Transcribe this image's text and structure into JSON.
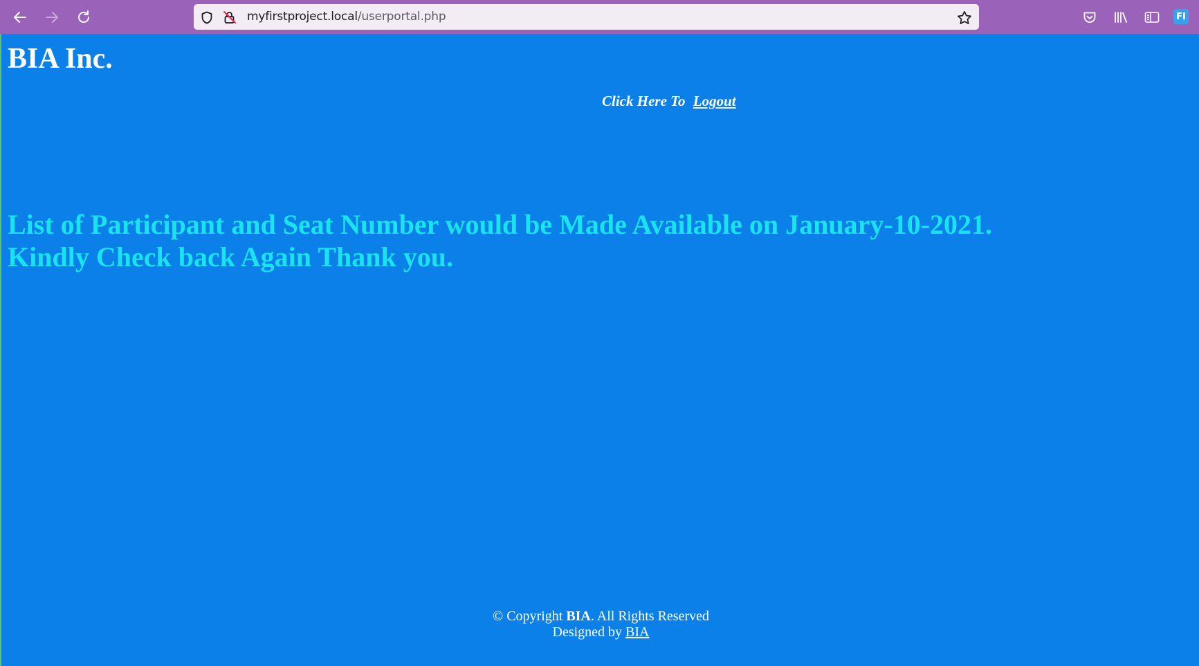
{
  "browser": {
    "url_host": "myfirstproject.local",
    "url_path": "/userportal.php",
    "toolbar_color": "#9a63b9",
    "icons": {
      "back": "back-arrow-icon",
      "forward": "forward-arrow-icon",
      "reload": "reload-icon",
      "shield": "tracking-protection-shield-icon",
      "lock": "insecure-lock-icon",
      "bookmark": "bookmark-star-icon",
      "pocket": "pocket-icon",
      "library": "library-icon",
      "sidebar": "sidebar-icon",
      "account": "account-icon"
    },
    "account_initials": "FI"
  },
  "page": {
    "background": "#0a80e8",
    "site_title": "BIA Inc.",
    "logout_prefix": "Click Here To",
    "logout_link": "Logout",
    "notice_line1": "List of Participant and Seat Number would be Made Available on January-10-2021.",
    "notice_line2": "Kindly Check back Again Thank you.",
    "notice_color": "#19e3ef"
  },
  "footer": {
    "copyright_prefix": "© Copyright",
    "copyright_brand": "BIA",
    "copyright_suffix": ". All Rights Reserved",
    "designed_by_prefix": "Designed by",
    "designed_by_link": "BIA"
  }
}
